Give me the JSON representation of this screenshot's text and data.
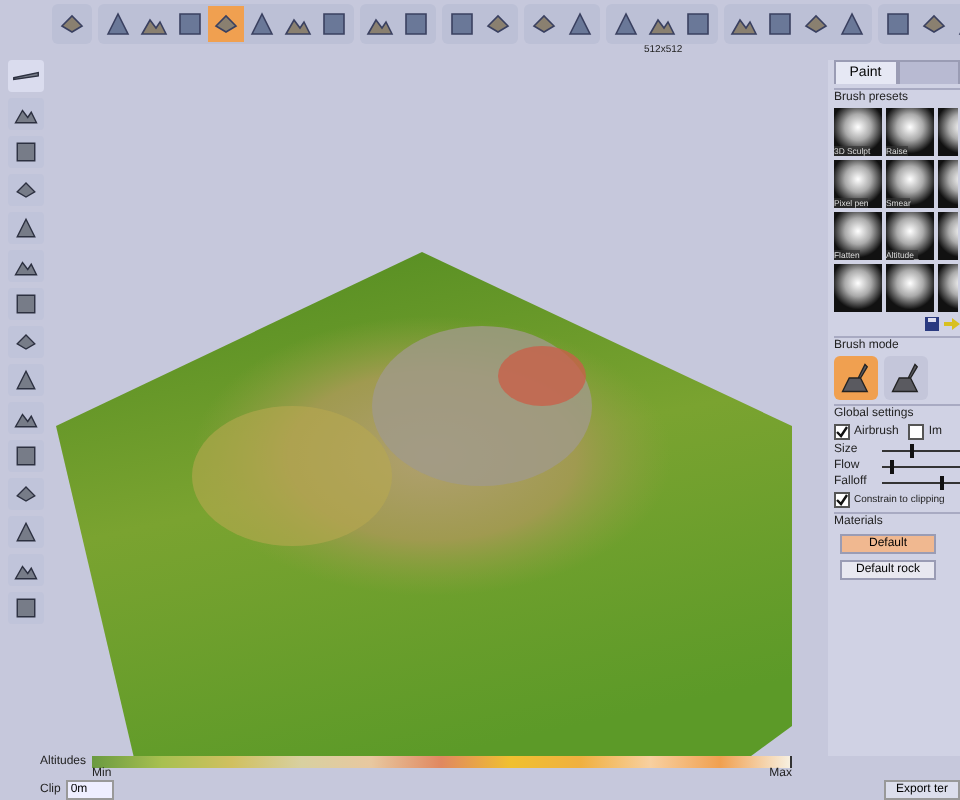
{
  "toolbar": {
    "groups": [
      {
        "buttons": [
          {
            "selected": false
          }
        ]
      },
      {
        "buttons": [
          {
            "selected": false
          },
          {
            "selected": false
          },
          {
            "selected": false
          },
          {
            "selected": true
          },
          {
            "selected": false
          },
          {
            "selected": false
          },
          {
            "selected": false
          }
        ]
      },
      {
        "buttons": [
          {
            "selected": false
          },
          {
            "selected": false
          }
        ]
      },
      {
        "buttons": [
          {
            "selected": false
          },
          {
            "selected": false
          }
        ]
      },
      {
        "buttons": [
          {
            "selected": false
          },
          {
            "selected": false
          }
        ]
      },
      {
        "buttons": [
          {
            "selected": false
          },
          {
            "selected": false,
            "caption": "512x512"
          },
          {
            "selected": false
          }
        ]
      },
      {
        "buttons": [
          {
            "selected": false
          },
          {
            "selected": false
          },
          {
            "selected": false
          },
          {
            "selected": false
          }
        ]
      },
      {
        "buttons": [
          {
            "selected": false
          },
          {
            "selected": false
          },
          {
            "selected": false
          }
        ]
      }
    ]
  },
  "tools": [
    {
      "selected": true
    },
    {
      "selected": false
    },
    {
      "selected": false
    },
    {
      "selected": false
    },
    {
      "selected": false
    },
    {
      "selected": false
    },
    {
      "selected": false
    },
    {
      "selected": false
    },
    {
      "selected": false
    },
    {
      "selected": false
    },
    {
      "selected": false
    },
    {
      "selected": false
    },
    {
      "selected": false
    },
    {
      "selected": false
    },
    {
      "selected": false
    }
  ],
  "panel": {
    "tabs": [
      {
        "label": "Paint",
        "selected": true
      },
      {
        "selected": false
      }
    ],
    "brush_presets": {
      "title": "Brush presets",
      "items": [
        {
          "kind": "named",
          "label": "3D Sculpt"
        },
        {
          "kind": "named",
          "label": "Raise"
        },
        {
          "kind": "plain"
        },
        {
          "kind": "named",
          "label": "Pixel pen"
        },
        {
          "kind": "named",
          "label": "Smear"
        },
        {
          "kind": "plain"
        },
        {
          "kind": "named",
          "label": "Flatten"
        },
        {
          "kind": "named",
          "label": "Altitude_"
        },
        {
          "kind": "plain"
        },
        {
          "kind": "plain"
        },
        {
          "kind": "plain"
        },
        {
          "kind": "plain"
        }
      ]
    },
    "brush_mode": {
      "title": "Brush mode",
      "modes": [
        {
          "selected": true
        },
        {
          "selected": false
        }
      ]
    },
    "global_settings": {
      "title": "Global settings",
      "checks": [
        {
          "label": "Airbrush",
          "checked": true
        },
        {
          "label": "Im",
          "checked": false
        }
      ],
      "sliders": [
        {
          "name": "Size",
          "level": 0.35
        },
        {
          "name": "Flow",
          "level": 0.1
        },
        {
          "name": "Falloff",
          "level": 0.75
        }
      ],
      "constrain": {
        "label": "Constrain to clipping",
        "checked": true
      }
    },
    "materials": {
      "title": "Materials",
      "items": [
        {
          "label": "Default",
          "selected": true
        },
        {
          "label": "Default rock",
          "selected": false
        }
      ]
    }
  },
  "altitudes": {
    "label": "Altitudes",
    "min": "Min",
    "max": "Max"
  },
  "bottom": {
    "clip_label": "Clip",
    "clip_value": "0m",
    "export_button": "Export ter"
  }
}
